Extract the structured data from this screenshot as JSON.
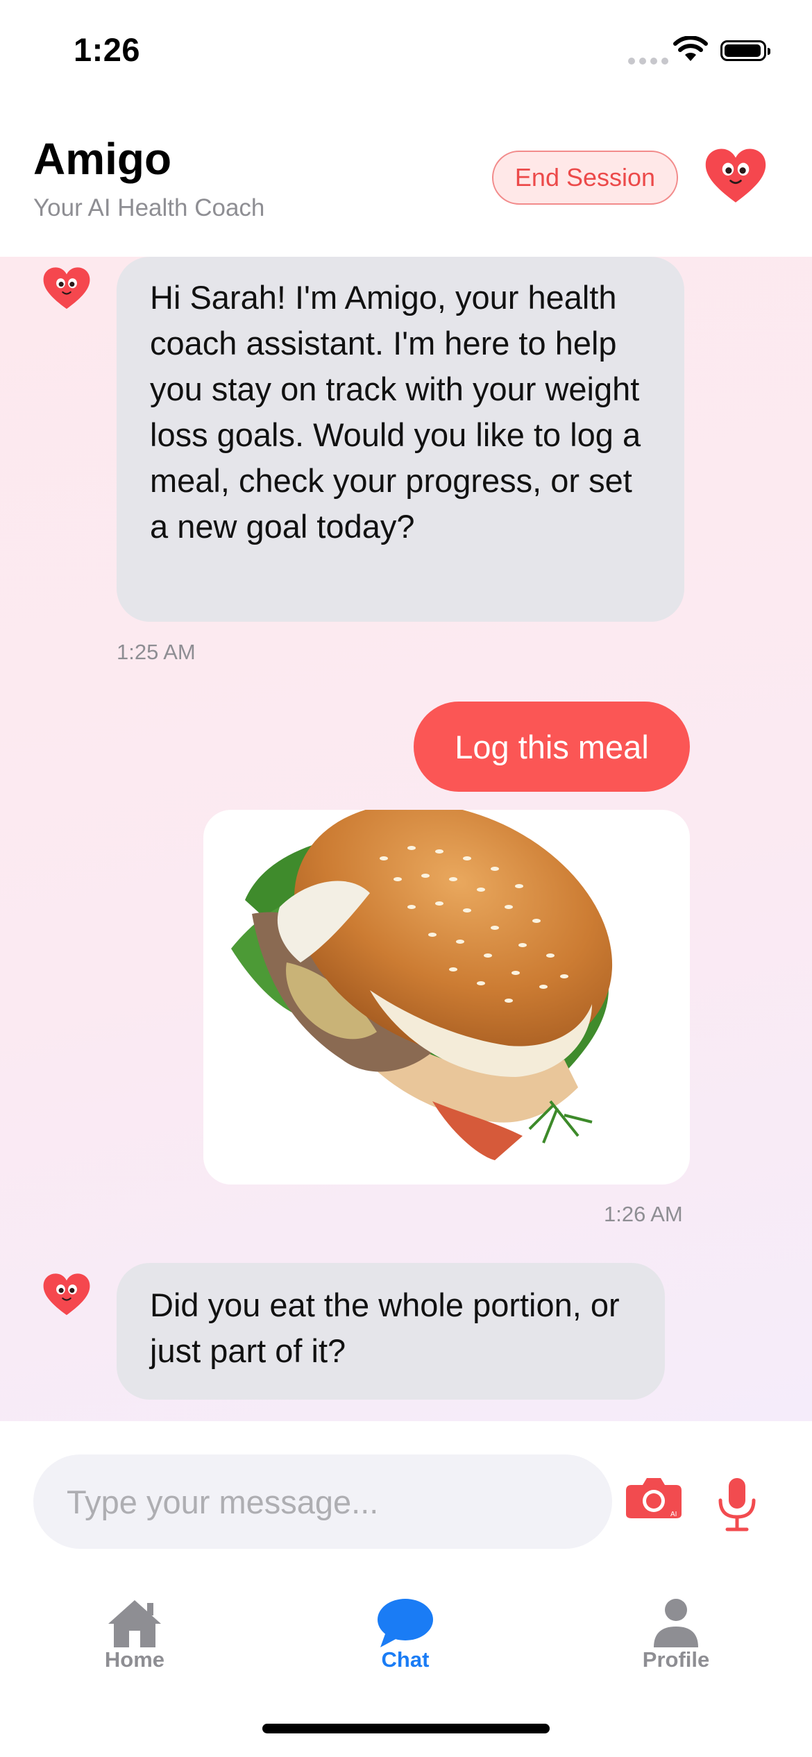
{
  "status": {
    "time": "1:26"
  },
  "header": {
    "title": "Amigo",
    "subtitle": "Your AI Health Coach",
    "end_session_label": "End Session"
  },
  "messages": [
    {
      "role": "assistant",
      "text": "Hi Sarah! I'm Amigo, your health coach assistant. I'm here to help you stay on track with your weight loss goals. Would you like to log a meal, check your progress, or set a new goal today?",
      "time": "1:25 AM"
    },
    {
      "role": "user",
      "text": "Log this meal",
      "attachment": "burger-photo",
      "time": "1:26 AM"
    },
    {
      "role": "assistant",
      "text": "Did you eat the whole portion, or just part of it?"
    }
  ],
  "input": {
    "placeholder": "Type your message...",
    "value": ""
  },
  "tabs": [
    {
      "label": "Home",
      "icon": "house-icon",
      "active": false
    },
    {
      "label": "Chat",
      "icon": "chat-bubble-icon",
      "active": true
    },
    {
      "label": "Profile",
      "icon": "person-icon",
      "active": false
    }
  ],
  "colors": {
    "accent": "#fb5655",
    "active_tab": "#1a7cf5",
    "inactive_tab": "#8e8e93",
    "bot_bubble": "#e5e5ea"
  }
}
